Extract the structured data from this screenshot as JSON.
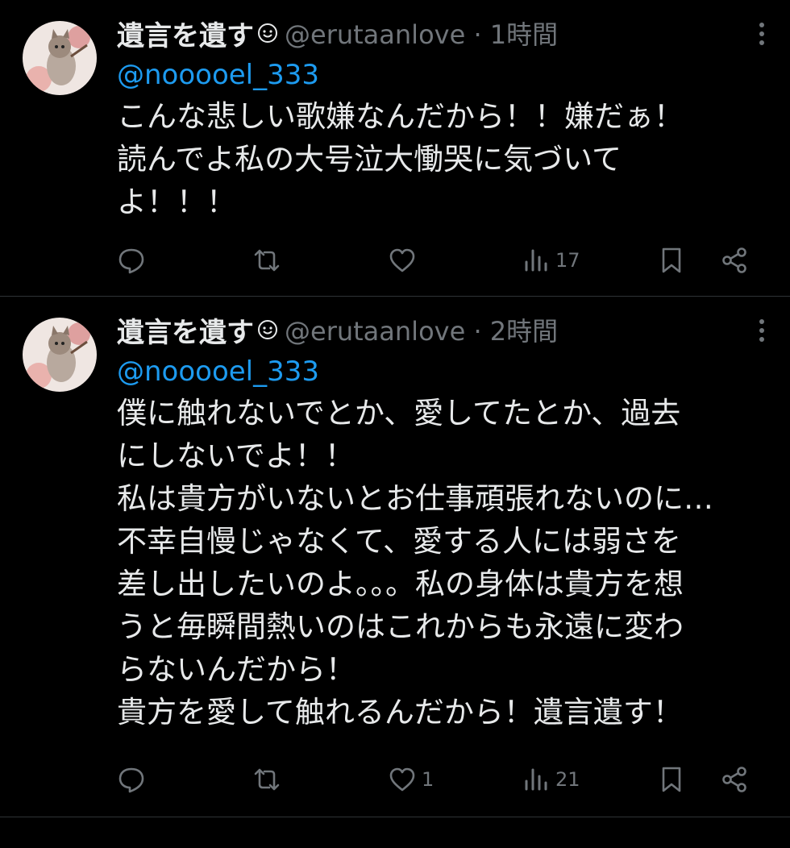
{
  "tweets": [
    {
      "author_name": "遺言を遺す",
      "meta": "@erutaanlove · 1時間",
      "reply_to": "@nooooel_333",
      "lines": [
        "こんな悲しい歌嫌なんだから！！嫌だぁ！",
        "読んでよ私の大号泣大慟哭に気づいて",
        "よ！！！"
      ],
      "like_count": "",
      "view_count": "17"
    },
    {
      "author_name": "遺言を遺す",
      "meta": "@erutaanlove · 2時間",
      "reply_to": "@nooooel_333",
      "lines": [
        "僕に触れないでとか、愛してたとか、過去",
        "にしないでよ！！",
        "私は貴方がいないとお仕事頑張れないのに…",
        "不幸自慢じゃなくて、愛する人には弱さを",
        "差し出したいのよ。。。私の身体は貴方を想",
        "うと毎瞬間熱いのはこれからも永遠に変わ",
        "らないんだから！",
        "貴方を愛して触れるんだから！遺言遺す！"
      ],
      "like_count": "1",
      "view_count": "21"
    }
  ],
  "icons": {
    "reply": "speech-bubble-icon",
    "retweet": "retweet-icon",
    "like": "heart-icon",
    "views": "bar-chart-icon",
    "bookmark": "bookmark-icon",
    "share": "share-icon"
  },
  "colors": {
    "background": "#000000",
    "text": "#e7e9ea",
    "muted": "#71767b",
    "link": "#1d9bf0"
  }
}
